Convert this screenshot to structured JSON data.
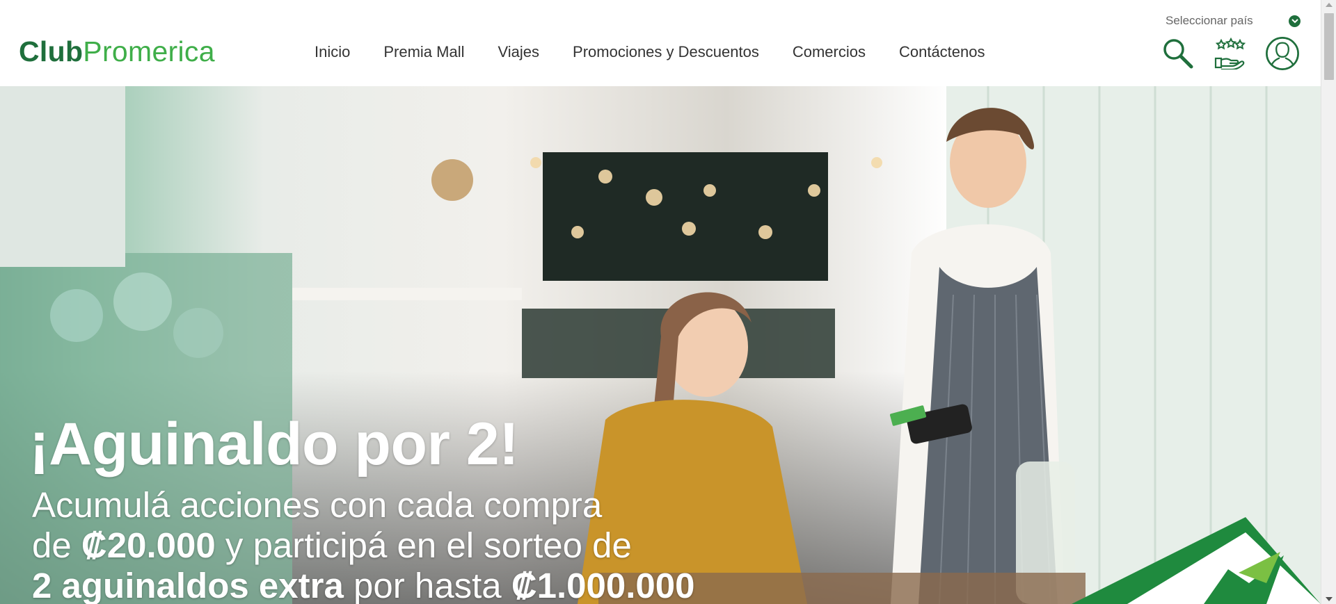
{
  "brand": {
    "club": "Club",
    "promerica": "Promerica"
  },
  "nav": {
    "items": [
      {
        "label": "Inicio"
      },
      {
        "label": "Premia Mall"
      },
      {
        "label": "Viajes"
      },
      {
        "label": "Promociones y Descuentos"
      },
      {
        "label": "Comercios"
      },
      {
        "label": "Contáctenos"
      }
    ]
  },
  "country_selector": {
    "label": "Seleccionar país",
    "icon": "chevron-down-icon"
  },
  "header_icons": {
    "search": "search-icon",
    "rewards": "rewards-hand-icon",
    "account": "user-account-icon"
  },
  "hero": {
    "title": "¡Aguinaldo por 2!",
    "line1": "Acumulá acciones con cada compra",
    "line2_pre": "de ",
    "line2_bold": "₡20.000",
    "line2_post": " y participá en el sorteo de",
    "line3_bold": "2 aguinaldos extra",
    "line3_mid": " por hasta ",
    "line3_amount": "₡1.000.000"
  },
  "colors": {
    "brand_dark": "#1f6f3c",
    "brand_light": "#3fae49",
    "nav_text": "#333333"
  }
}
